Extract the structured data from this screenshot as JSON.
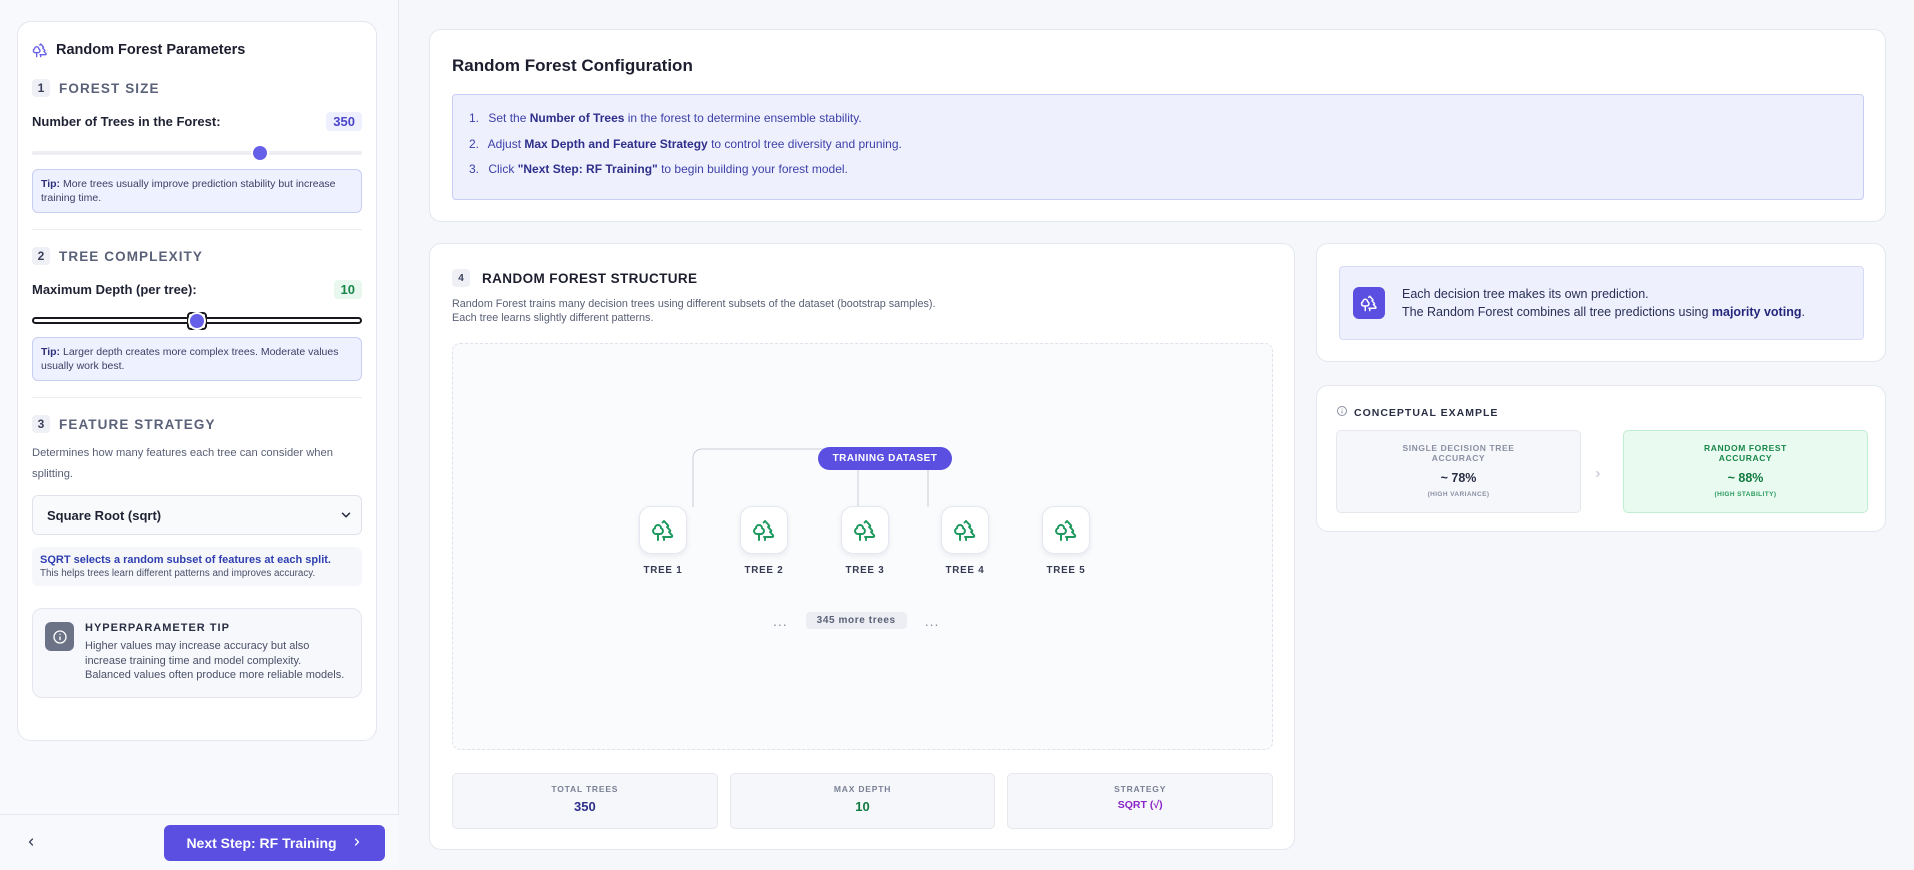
{
  "sidebar": {
    "title": "Random Forest Parameters",
    "forest_size": {
      "num": "1",
      "title": "FOREST SIZE",
      "label": "Number of Trees in the Forest:",
      "value": "350",
      "slider_fraction": 0.69,
      "tip_bold": "Tip:",
      "tip_text": " More trees usually improve prediction stability but increase training time."
    },
    "tree_complexity": {
      "num": "2",
      "title": "TREE COMPLEXITY",
      "label": "Maximum Depth (per tree):",
      "value": "10",
      "slider_fraction": 0.5,
      "tip_bold": "Tip:",
      "tip_text": " Larger depth creates more complex trees. Moderate values usually work best."
    },
    "feature_strategy": {
      "num": "3",
      "title": "FEATURE STRATEGY",
      "description": "Determines how many features each tree can consider when splitting.",
      "selected": "Square Root (sqrt)",
      "info_line1": "SQRT selects a random subset of features at each split.",
      "info_line2": "This helps trees learn different patterns and improves accuracy."
    },
    "hyperparameter_tip": {
      "title": "HYPERPARAMETER TIP",
      "text": "Higher values may increase accuracy but also increase training time and model complexity. Balanced values often produce more reliable models."
    },
    "next_button": "Next Step: RF Training"
  },
  "config": {
    "title": "Random Forest Configuration",
    "steps": [
      {
        "n": "1.",
        "pre": "Set the ",
        "bold": "Number of Trees",
        "post": " in the forest to determine ensemble stability."
      },
      {
        "n": "2.",
        "pre": "Adjust ",
        "bold": "Max Depth and Feature Strategy",
        "post": " to control tree diversity and pruning."
      },
      {
        "n": "3.",
        "pre": "Click ",
        "bold": "\"Next Step: RF Training\"",
        "post": " to begin building your forest model."
      }
    ]
  },
  "structure": {
    "num": "4",
    "title": "RANDOM FOREST STRUCTURE",
    "desc_line1": "Random Forest trains many decision trees using different subsets of the dataset (bootstrap samples).",
    "desc_line2": "Each tree learns slightly different patterns.",
    "dataset_label": "TRAINING DATASET",
    "trees": [
      "TREE 1",
      "TREE 2",
      "TREE 3",
      "TREE 4",
      "TREE 5"
    ],
    "more_dots": "...",
    "more_label": "345 more trees",
    "stats": [
      {
        "label": "TOTAL TREES",
        "value": "350",
        "color": "#2e2f8a"
      },
      {
        "label": "MAX DEPTH",
        "value": "10",
        "color": "#117a40"
      },
      {
        "label": "STRATEGY",
        "value": "SQRT (√)",
        "color": "#8a24c8"
      }
    ]
  },
  "voting": {
    "line1": "Each decision tree makes its own prediction.",
    "line2_pre": "The Random Forest combines all tree predictions using ",
    "line2_bold": "majority voting",
    "line2_post": "."
  },
  "concept": {
    "title": "CONCEPTUAL EXAMPLE",
    "single": {
      "label_l1": "SINGLE DECISION TREE",
      "label_l2": "ACCURACY",
      "value": "~ 78%",
      "sub": "(HIGH VARIANCE)"
    },
    "rf": {
      "label_l1": "RANDOM FOREST",
      "label_l2": "ACCURACY",
      "value": "~ 88%",
      "sub": "(HIGH STABILITY)"
    }
  },
  "colors": {
    "accent": "#5a4fe0",
    "green": "#19874a",
    "tree_icon": "#1f9a5e"
  },
  "icons": {
    "header": "trees-icon",
    "select": "chevron-down-icon",
    "info": "info-icon",
    "back": "chevron-left-icon",
    "next": "chevron-right-icon",
    "tree": "tree-icon"
  }
}
